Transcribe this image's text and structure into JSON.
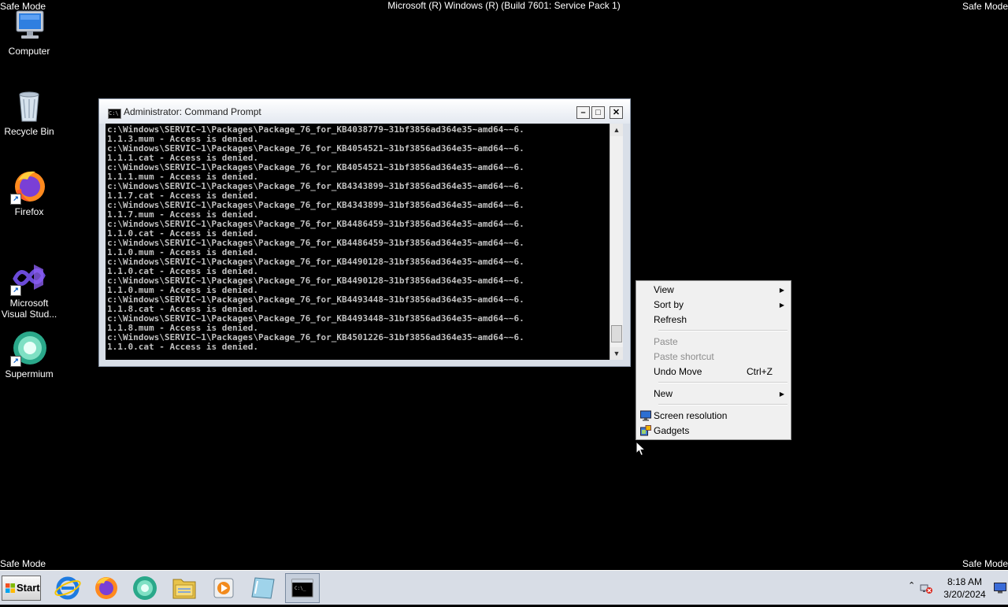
{
  "top_bar": {
    "safe_mode_left": "Safe Mode",
    "safe_mode_right": "Safe Mode",
    "build_text": "Microsoft (R) Windows (R) (Build 7601: Service Pack 1)"
  },
  "bottom_bar": {
    "safe_mode_left": "Safe Mode",
    "safe_mode_right": "Safe Mode"
  },
  "desktop_icons": [
    {
      "label": "Computer",
      "icon": "computer-icon"
    },
    {
      "label": "Recycle Bin",
      "icon": "recycle-bin-icon"
    },
    {
      "label": "Firefox",
      "icon": "firefox-icon"
    },
    {
      "label": "Microsoft Visual Stud...",
      "icon": "visual-studio-icon"
    },
    {
      "label": "Supermium",
      "icon": "supermium-icon"
    }
  ],
  "cmd_window": {
    "title": "Administrator:  Command Prompt",
    "lines": [
      "c:\\Windows\\SERVIC~1\\Packages\\Package_76_for_KB4038779~31bf3856ad364e35~amd64~~6.",
      "1.1.3.mum - Access is denied.",
      "c:\\Windows\\SERVIC~1\\Packages\\Package_76_for_KB4054521~31bf3856ad364e35~amd64~~6.",
      "1.1.1.cat - Access is denied.",
      "c:\\Windows\\SERVIC~1\\Packages\\Package_76_for_KB4054521~31bf3856ad364e35~amd64~~6.",
      "1.1.1.mum - Access is denied.",
      "c:\\Windows\\SERVIC~1\\Packages\\Package_76_for_KB4343899~31bf3856ad364e35~amd64~~6.",
      "1.1.7.cat - Access is denied.",
      "c:\\Windows\\SERVIC~1\\Packages\\Package_76_for_KB4343899~31bf3856ad364e35~amd64~~6.",
      "1.1.7.mum - Access is denied.",
      "c:\\Windows\\SERVIC~1\\Packages\\Package_76_for_KB4486459~31bf3856ad364e35~amd64~~6.",
      "1.1.0.cat - Access is denied.",
      "c:\\Windows\\SERVIC~1\\Packages\\Package_76_for_KB4486459~31bf3856ad364e35~amd64~~6.",
      "1.1.0.mum - Access is denied.",
      "c:\\Windows\\SERVIC~1\\Packages\\Package_76_for_KB4490128~31bf3856ad364e35~amd64~~6.",
      "1.1.0.cat - Access is denied.",
      "c:\\Windows\\SERVIC~1\\Packages\\Package_76_for_KB4490128~31bf3856ad364e35~amd64~~6.",
      "1.1.0.mum - Access is denied.",
      "c:\\Windows\\SERVIC~1\\Packages\\Package_76_for_KB4493448~31bf3856ad364e35~amd64~~6.",
      "1.1.8.cat - Access is denied.",
      "c:\\Windows\\SERVIC~1\\Packages\\Package_76_for_KB4493448~31bf3856ad364e35~amd64~~6.",
      "1.1.8.mum - Access is denied.",
      "c:\\Windows\\SERVIC~1\\Packages\\Package_76_for_KB4501226~31bf3856ad364e35~amd64~~6.",
      "1.1.0.cat - Access is denied."
    ]
  },
  "context_menu": {
    "view": "View",
    "sort_by": "Sort by",
    "refresh": "Refresh",
    "paste": "Paste",
    "paste_shortcut": "Paste shortcut",
    "undo_move": "Undo Move",
    "undo_move_shortcut": "Ctrl+Z",
    "new": "New",
    "screen_resolution": "Screen resolution",
    "gadgets": "Gadgets"
  },
  "taskbar": {
    "start_label": "Start",
    "pinned": [
      "internet-explorer-icon",
      "firefox-icon",
      "supermium-icon",
      "file-explorer-icon",
      "media-player-icon",
      "notepad-icon",
      "command-prompt-icon"
    ],
    "clock_time": "8:18 AM",
    "clock_date": "3/20/2024"
  },
  "colors": {
    "desktop_bg": "#000000",
    "console_text": "#c0c0c0",
    "taskbar_bg": "#d8dde6",
    "menu_bg": "#f0f0f0"
  }
}
